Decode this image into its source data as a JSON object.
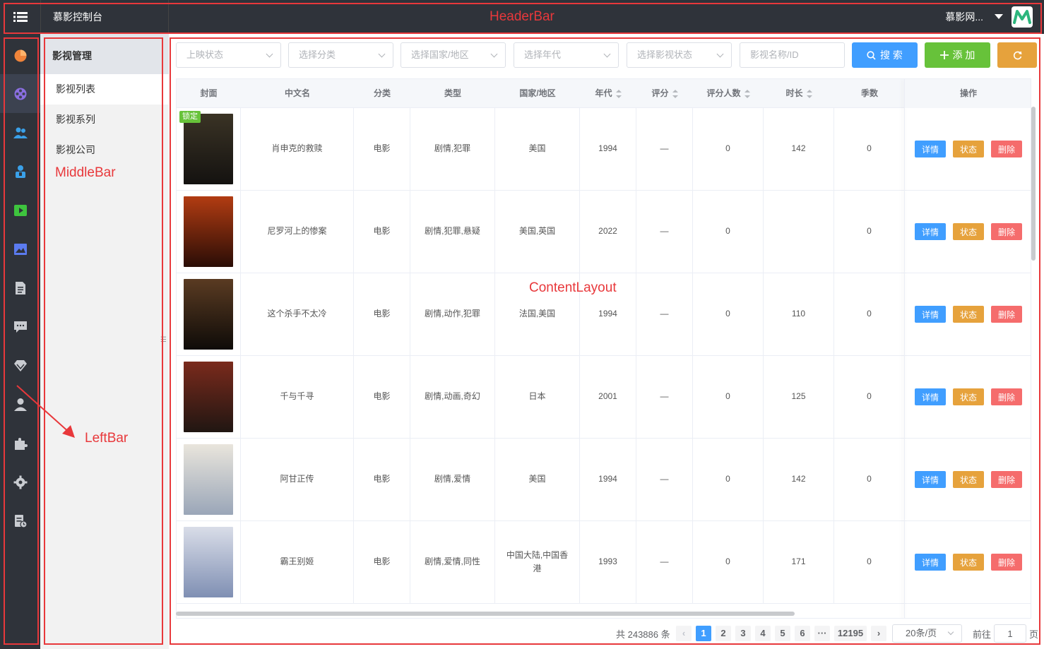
{
  "header": {
    "title": "慕影控制台",
    "user": "慕影网...",
    "logo_text": "M"
  },
  "leftbar": {
    "icons": [
      "dashboard-icon",
      "film-reel-icon",
      "users-icon",
      "staff-icon",
      "video-play-icon",
      "image-icon",
      "document-icon",
      "comment-icon",
      "diamond-icon",
      "user-icon",
      "plugin-icon",
      "settings-icon",
      "log-icon"
    ]
  },
  "middlebar": {
    "title": "影视管理",
    "items": [
      "影视列表",
      "影视系列",
      "影视公司"
    ]
  },
  "filters": {
    "release_status": "上映状态",
    "category": "选择分类",
    "country": "选择国家/地区",
    "decade": "选择年代",
    "film_status": "选择影视状态",
    "name_placeholder": "影视名称/ID",
    "search_label": "搜 索",
    "add_label": "添 加"
  },
  "table": {
    "columns": [
      "封面",
      "中文名",
      "分类",
      "类型",
      "国家/地区",
      "年代",
      "评分",
      "评分人数",
      "时长",
      "季数",
      "操作"
    ],
    "lock_badge": "锁定",
    "actions": {
      "detail": "详情",
      "status": "状态",
      "delete": "删除"
    },
    "rows": [
      {
        "name": "肖申克的救赎",
        "category": "电影",
        "genre": "剧情,犯罪",
        "country": "美国",
        "year": "1994",
        "rating": "—",
        "rating_count": "0",
        "duration": "142",
        "seasons": "0",
        "locked": true
      },
      {
        "name": "尼罗河上的惨案",
        "category": "电影",
        "genre": "剧情,犯罪,悬疑",
        "country": "美国,英国",
        "year": "2022",
        "rating": "—",
        "rating_count": "0",
        "duration": "",
        "seasons": "0",
        "locked": false
      },
      {
        "name": "这个杀手不太冷",
        "category": "电影",
        "genre": "剧情,动作,犯罪",
        "country": "法国,美国",
        "year": "1994",
        "rating": "—",
        "rating_count": "0",
        "duration": "110",
        "seasons": "0",
        "locked": false
      },
      {
        "name": "千与千寻",
        "category": "电影",
        "genre": "剧情,动画,奇幻",
        "country": "日本",
        "year": "2001",
        "rating": "—",
        "rating_count": "0",
        "duration": "125",
        "seasons": "0",
        "locked": false
      },
      {
        "name": "阿甘正传",
        "category": "电影",
        "genre": "剧情,爱情",
        "country": "美国",
        "year": "1994",
        "rating": "—",
        "rating_count": "0",
        "duration": "142",
        "seasons": "0",
        "locked": false
      },
      {
        "name": "霸王别姬",
        "category": "电影",
        "genre": "剧情,爱情,同性",
        "country": "中国大陆,中国香港",
        "year": "1993",
        "rating": "—",
        "rating_count": "0",
        "duration": "171",
        "seasons": "0",
        "locked": false
      }
    ]
  },
  "pagination": {
    "total": "共 243886 条",
    "pages": [
      "1",
      "2",
      "3",
      "4",
      "5",
      "6"
    ],
    "ellipsis": "···",
    "last_page": "12195",
    "current": "1",
    "page_size": "20条/页",
    "goto_prefix": "前往",
    "goto_value": "1",
    "goto_suffix": "页"
  },
  "annotations": {
    "header": "HeaderBar",
    "middle": "MiddleBar",
    "content": "ContentLayout",
    "left": "LeftBar"
  },
  "colors": {
    "primary": "#409eff",
    "success": "#67c23a",
    "warning": "#e6a23c",
    "danger": "#f56c6c",
    "annotation": "#e8383b"
  }
}
